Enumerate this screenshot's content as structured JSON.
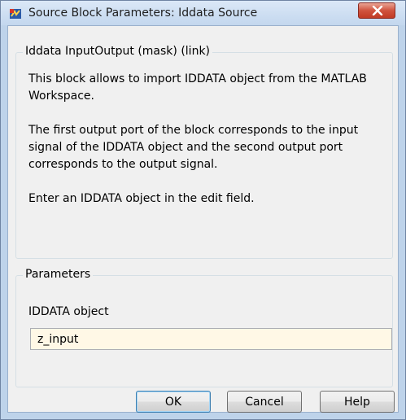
{
  "window": {
    "title": "Source Block Parameters: Iddata Source"
  },
  "description": {
    "group_title": "Iddata InputOutput (mask) (link)",
    "paragraphs": [
      "This block allows to import IDDATA object from the MATLAB Workspace.",
      "The first output port of the block corresponds to the input signal of the IDDATA object and the second output port corresponds to the output signal.",
      "Enter an IDDATA object in the edit field."
    ]
  },
  "parameters": {
    "group_title": "Parameters",
    "iddata_object_label": "IDDATA object",
    "iddata_object_value": "z_input"
  },
  "buttons": {
    "ok_label": "OK",
    "cancel_label": "Cancel",
    "help_label": "Help"
  },
  "colors": {
    "title_bar": "#c3d7ee",
    "close_button": "#c13a24",
    "input_background": "#fff8e6",
    "dialog_background": "#f0f0f0"
  },
  "icons": {
    "app": "simulink-block-icon",
    "close": "close-x-icon"
  }
}
